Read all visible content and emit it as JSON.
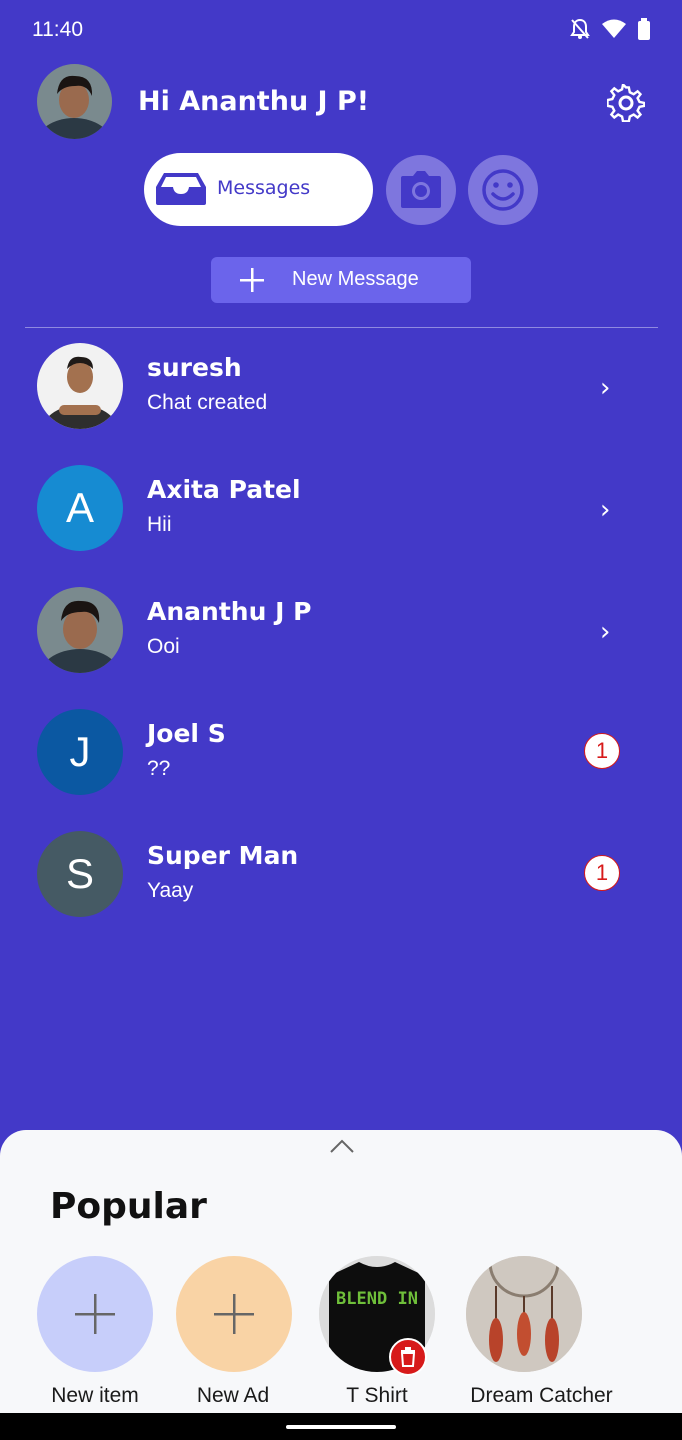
{
  "status_bar": {
    "time": "11:40",
    "icons": [
      "bell-off-icon",
      "wifi-icon",
      "battery-icon"
    ]
  },
  "header": {
    "greeting": "Hi Ananthu J P!",
    "settings_icon": "gear-icon"
  },
  "segmented": {
    "messages_label": "Messages",
    "camera_icon": "camera-icon",
    "emoji_icon": "smile-icon"
  },
  "new_message": {
    "label": "New Message"
  },
  "chats": [
    {
      "name": "suresh",
      "message": "Chat created",
      "avatar": "photo",
      "chevron": "›"
    },
    {
      "name": "Axita Patel",
      "message": "Hii",
      "avatar_letter": "A",
      "avatar_color": "#168BD2",
      "chevron": "›"
    },
    {
      "name": "Ananthu J P",
      "message": "Ooi",
      "avatar": "photo",
      "chevron": "›"
    },
    {
      "name": "Joel S",
      "message": "??",
      "avatar_letter": "J",
      "avatar_color": "#0B58A2",
      "unread": "1"
    },
    {
      "name": "Super Man",
      "message": "Yaay",
      "avatar_letter": "S",
      "avatar_color": "#455A64",
      "unread": "1"
    }
  ],
  "popular": {
    "title": "Popular",
    "items": [
      {
        "label": "New item",
        "color": "#C7CEFA",
        "icon": "plus-icon"
      },
      {
        "label": "New Ad",
        "color": "#F9D3A5",
        "icon": "plus-icon"
      },
      {
        "label": "T Shirt",
        "image_text": "BLEND IN",
        "has_delete": true
      },
      {
        "label": "Dream Catcher"
      }
    ]
  },
  "colors": {
    "background": "#4339C8",
    "accent_button": "#6B64EB",
    "badge_red": "#D71A1A"
  }
}
